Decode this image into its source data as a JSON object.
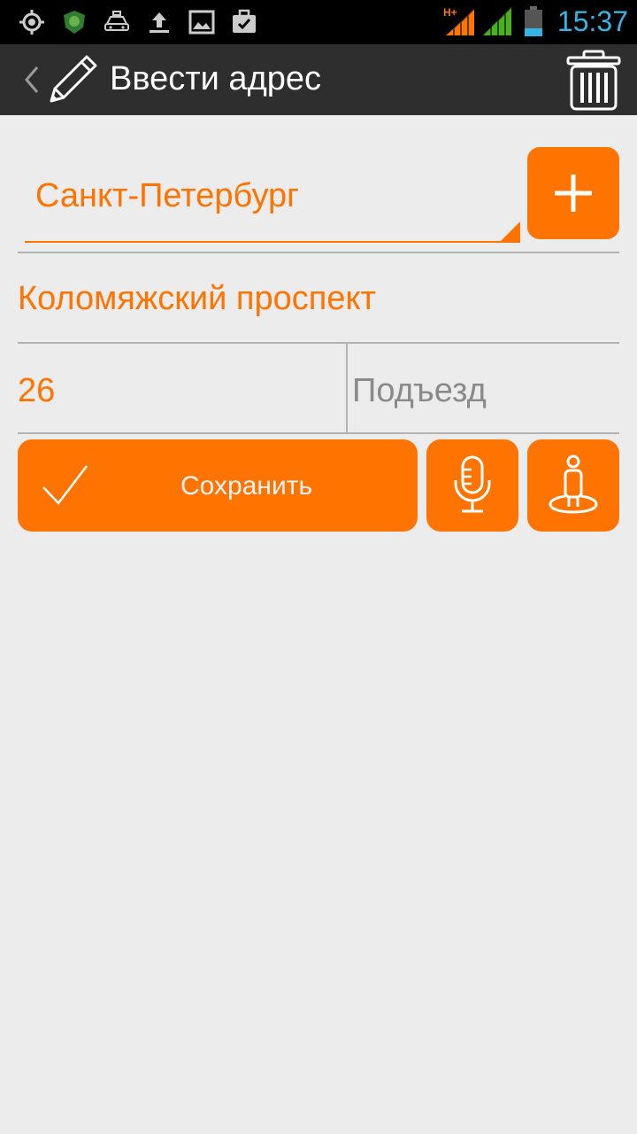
{
  "status_bar": {
    "time": "15:37",
    "network_type": "H+",
    "icons": [
      "gps-icon",
      "antivirus-shield-icon",
      "taxi-car-icon",
      "upload-icon",
      "gallery-icon",
      "briefcase-check-icon",
      "signal-orange-icon",
      "signal-green-icon",
      "battery-icon"
    ]
  },
  "action_bar": {
    "title": "Ввести адрес",
    "icons": [
      "back-chevron-icon",
      "pencil-icon",
      "trash-icon"
    ]
  },
  "form": {
    "city": "Санкт-Петербург",
    "street": "Коломяжский проспект",
    "house": "26",
    "entrance_placeholder": "Подъезд"
  },
  "buttons": {
    "save_label": "Сохранить"
  },
  "colors": {
    "accent": "#ff7300",
    "background": "#ececec",
    "action_bar": "#2e2e2e",
    "status_time": "#33b5e5"
  }
}
